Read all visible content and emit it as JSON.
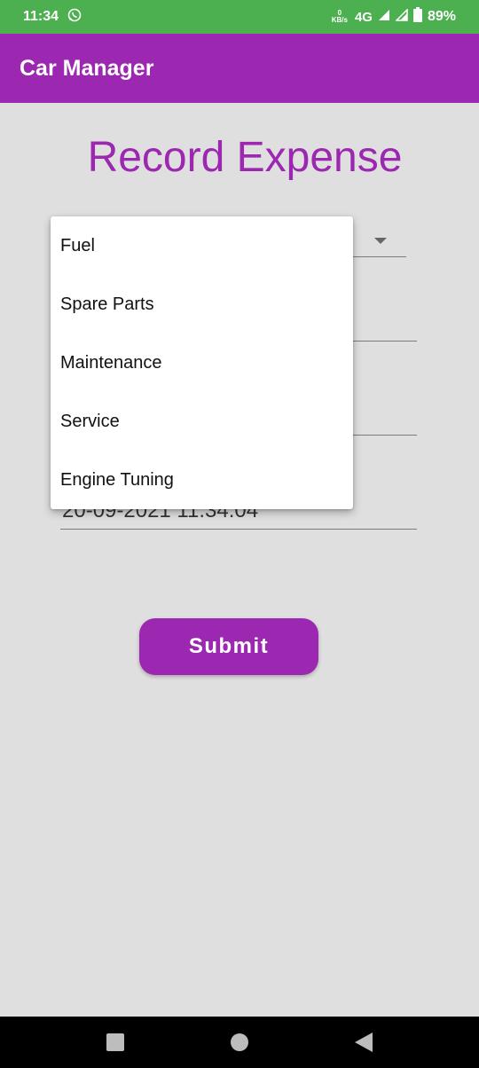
{
  "status_bar": {
    "time": "11:34",
    "net_speed_value": "0",
    "net_speed_unit": "KB/s",
    "network": "4G",
    "battery": "89%"
  },
  "app_bar": {
    "title": "Car Manager"
  },
  "page": {
    "title": "Record Expense"
  },
  "form": {
    "date_value": "20-09-2021 11:34:04",
    "submit_label": "Submit"
  },
  "dropdown": {
    "options": [
      "Fuel",
      "Spare Parts",
      "Maintenance",
      "Service",
      "Engine Tuning"
    ]
  },
  "colors": {
    "accent": "#9c27b0",
    "status_bar": "#4caf50",
    "background": "#e0dfdf"
  },
  "icons": [
    "whatsapp-icon",
    "signal-icon",
    "battery-icon",
    "dropdown-arrow-icon",
    "recents-icon",
    "home-icon",
    "back-icon"
  ]
}
